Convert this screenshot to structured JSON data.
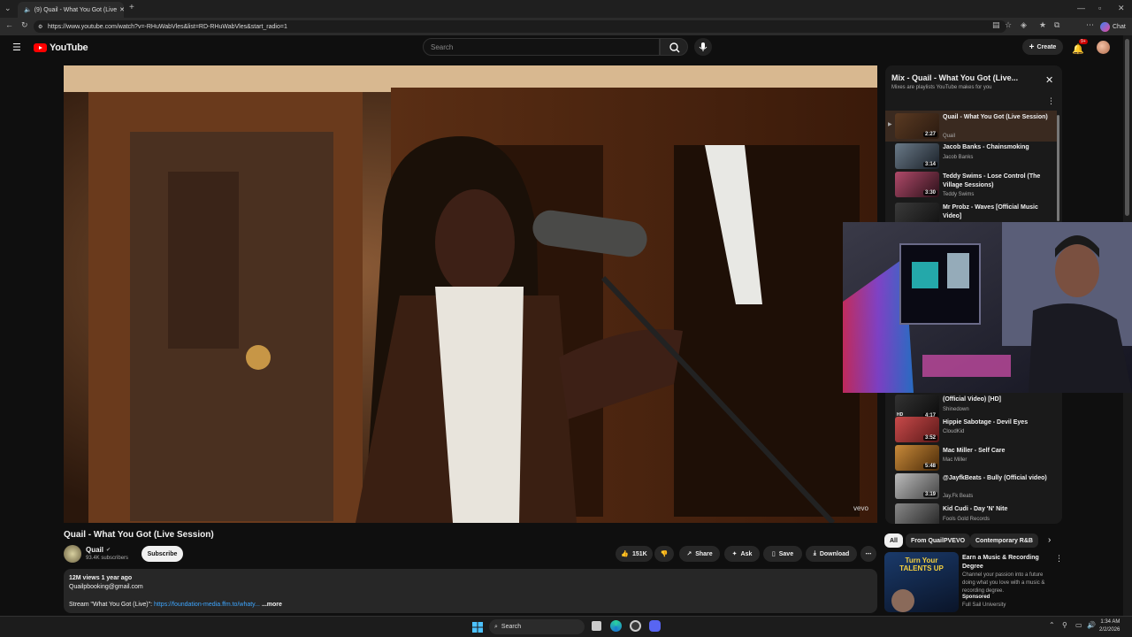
{
  "browser": {
    "tab_title": "(9) Quail - What You Got (Live",
    "url": "https://www.youtube.com/watch?v=-RHuWabVles&list=RD-RHuWabVles&start_radio=1",
    "chat_label": "Chat"
  },
  "header": {
    "logo_text": "YouTube",
    "search_placeholder": "Search",
    "create_label": "Create",
    "notifications_badge": "9+"
  },
  "video": {
    "title": "Quail - What You Got (Live Session)",
    "watermark": "vevo",
    "channel": "Quail",
    "subscribers": "93.4K subscribers",
    "subscribe_label": "Subscribe",
    "likes": "151K",
    "share_label": "Share",
    "ask_label": "Ask",
    "save_label": "Save",
    "download_label": "Download"
  },
  "description": {
    "stats": "12M views  1 year ago",
    "email": "Quailpbooking@gmail.com",
    "stream_prefix": "Stream \"What You Got (Live)\": ",
    "stream_link": "https://foundation-media.ffm.to/whaty...",
    "more_label": "...more"
  },
  "playlist": {
    "title": "Mix - Quail - What You Got (Live...",
    "subtitle": "Mixes are playlists YouTube makes for you",
    "items_top": [
      {
        "title": "Quail - What You Got (Live Session)",
        "channel": "Quail",
        "duration": "2:27"
      },
      {
        "title": "Jacob Banks - Chainsmoking",
        "channel": "Jacob Banks",
        "duration": "3:14"
      },
      {
        "title": "Teddy Swims - Lose Control (The Village Sessions)",
        "channel": "Teddy Swims",
        "duration": "3:30"
      },
      {
        "title": "Mr Probz - Waves [Official Music Video]",
        "channel": "",
        "duration": ""
      }
    ],
    "items_bottom": [
      {
        "title": "(Official Video) [HD]",
        "channel": "Shinedown",
        "duration": "4:17"
      },
      {
        "title": "Hippie Sabotage - Devil Eyes",
        "channel": "CloudKid",
        "duration": "3:52"
      },
      {
        "title": "Mac Miller - Self Care",
        "channel": "Mac Miller",
        "duration": "5:48"
      },
      {
        "title": "@JayfkBeats - Bully (Official video)",
        "channel": "Jay.Fk Beats",
        "duration": "3:19"
      },
      {
        "title": "Kid Cudi - Day 'N' Nite",
        "channel": "Fools Gold Records",
        "duration": ""
      }
    ]
  },
  "chips": [
    "All",
    "From QuailPVEVO",
    "Contemporary R&B"
  ],
  "ad": {
    "title": "Earn a Music & Recording Degree",
    "body": "Channel your passion into a future doing what you love with a music & recording degree.",
    "sponsored": "Sponsored",
    "advertiser": "Full Sail University",
    "thumb_text": "Turn Your TALENTS UP"
  },
  "taskbar": {
    "search_label": "Search",
    "time": "1:34 AM",
    "date": "2/2/2026"
  }
}
